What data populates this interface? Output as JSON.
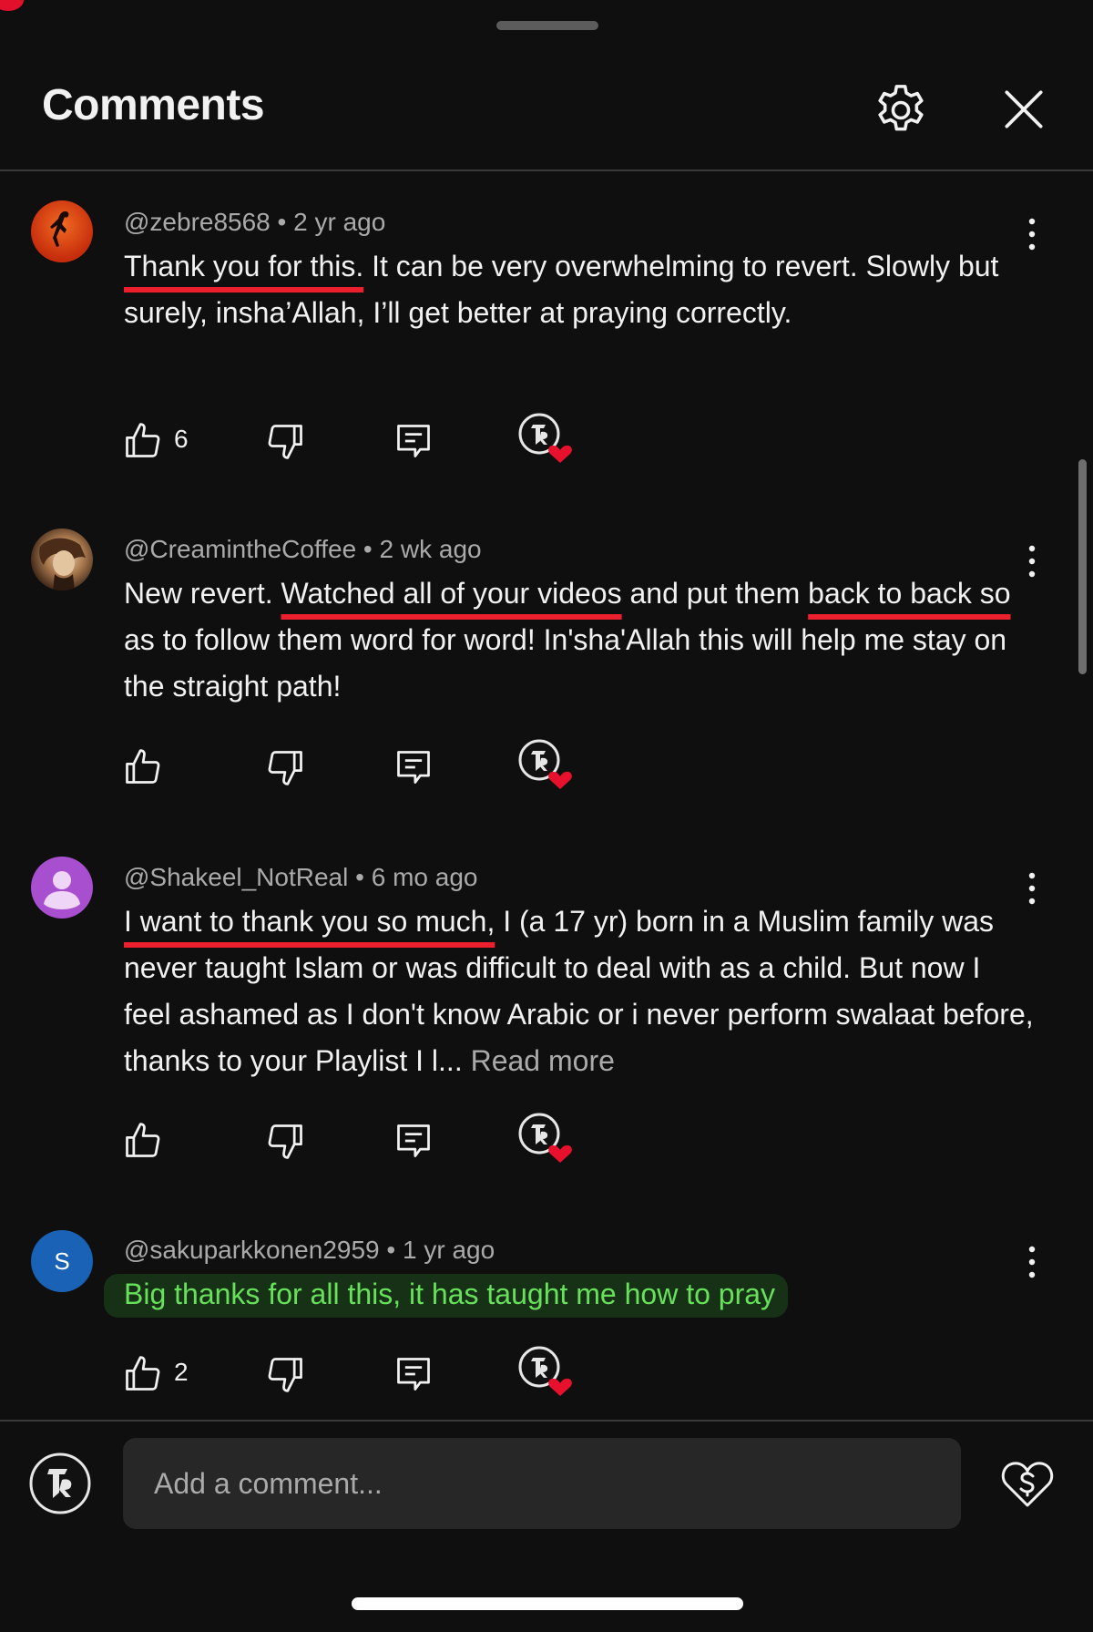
{
  "header": {
    "title": "Comments"
  },
  "comments": [
    {
      "author": "@zebre8568",
      "age": "2 yr ago",
      "text_highlight": "Thank you for this.",
      "text_rest": " It can be very overwhelming to revert. Slowly but surely,  insha’Allah, I’ll get better at praying correctly.",
      "likes": "6",
      "avatar_color": "#d23f12"
    },
    {
      "author": "@CreamintheCoffee",
      "age": "2 wk ago",
      "text_a": "New revert. ",
      "text_hl1": "Watched all of your videos",
      "text_b": " and put them ",
      "text_hl2": "back to back so",
      "text_c": " as to follow them word for word! In'sha'Allah this will help me stay on the straight path!",
      "likes": ""
    },
    {
      "author": "@Shakeel_NotReal",
      "age": "6 mo ago",
      "text_highlight": "I want to thank you so much,",
      "text_rest": " I (a 17 yr) born in a Muslim family was never taught Islam or was difficult to deal with as a child. But now I feel ashamed as I don't know Arabic or i never perform swalaat before, thanks to your Playlist I l...",
      "read_more": " Read more",
      "likes": "",
      "avatar_color": "#a84fd0"
    },
    {
      "author": "@sakuparkkonen2959",
      "age": "1 yr ago",
      "avatar_initial": "S",
      "avatar_color": "#1a62b5",
      "text_green": "Big thanks for all this, it has taught me how to pray",
      "likes": "2"
    }
  ],
  "composer": {
    "placeholder": "Add a comment..."
  },
  "colors": {
    "background": "#0f0f0f",
    "highlight_red": "#ec1f2c",
    "highlight_green": "#67e05a",
    "heart": "#e8112d"
  }
}
